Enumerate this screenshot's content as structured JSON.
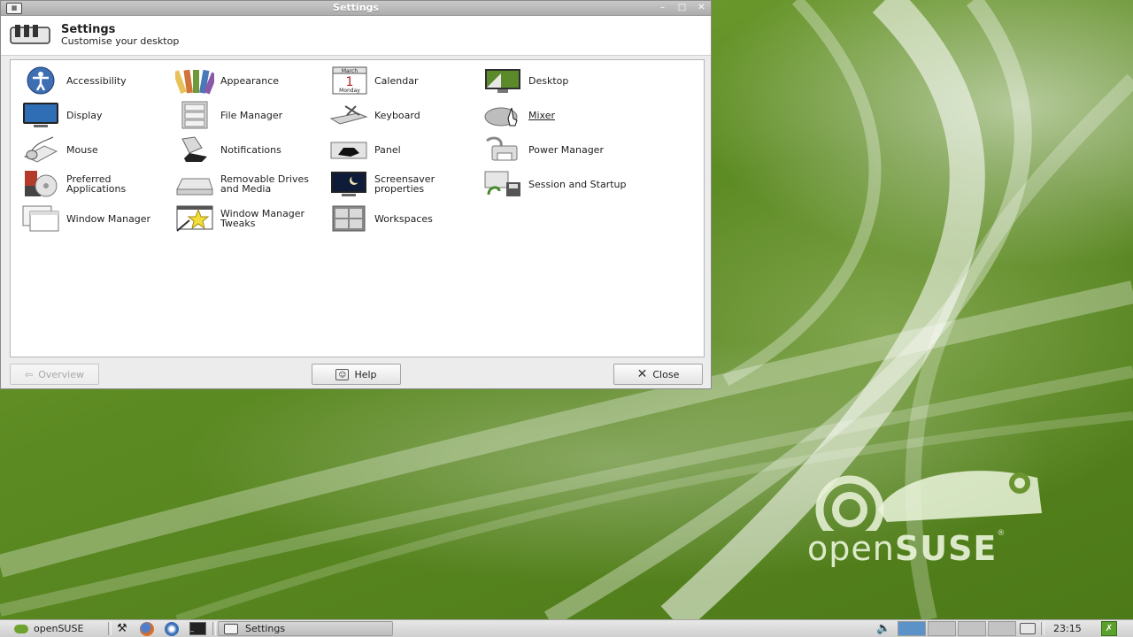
{
  "window": {
    "title": "Settings",
    "header_title": "Settings",
    "header_subtitle": "Customise your desktop"
  },
  "items": [
    {
      "label": "Accessibility",
      "icon": "accessibility-icon"
    },
    {
      "label": "Appearance",
      "icon": "appearance-icon"
    },
    {
      "label": "Calendar",
      "icon": "calendar-icon"
    },
    {
      "label": "Desktop",
      "icon": "desktop-icon"
    },
    {
      "label": "Display",
      "icon": "display-icon"
    },
    {
      "label": "File Manager",
      "icon": "file-manager-icon"
    },
    {
      "label": "Keyboard",
      "icon": "keyboard-icon"
    },
    {
      "label": "Mixer",
      "icon": "mixer-icon"
    },
    {
      "label": "Mouse",
      "icon": "mouse-icon"
    },
    {
      "label": "Notifications",
      "icon": "notifications-icon"
    },
    {
      "label": "Panel",
      "icon": "panel-icon"
    },
    {
      "label": "Power Manager",
      "icon": "power-manager-icon"
    },
    {
      "label": "Preferred Applications",
      "icon": "preferred-applications-icon"
    },
    {
      "label": "Removable Drives and Media",
      "icon": "removable-drives-icon"
    },
    {
      "label": "Screensaver properties",
      "icon": "screensaver-icon"
    },
    {
      "label": "Session and Startup",
      "icon": "session-startup-icon"
    },
    {
      "label": "Window Manager",
      "icon": "window-manager-icon"
    },
    {
      "label": "Window Manager Tweaks",
      "icon": "window-manager-tweaks-icon"
    },
    {
      "label": "Workspaces",
      "icon": "workspaces-icon"
    }
  ],
  "calendar_icon": {
    "month": "March",
    "day": "1",
    "weekday": "Monday"
  },
  "buttons": {
    "overview": "Overview",
    "help": "Help",
    "close": "Close"
  },
  "taskbar": {
    "menu_label": "openSUSE",
    "task_label": "Settings",
    "clock": "23:15"
  },
  "wallpaper": {
    "brand_open": "open",
    "brand_suse": "SUSE",
    "brand_mark": "®"
  },
  "colors": {
    "wallpaper_green": "#5f8a1f",
    "active_workspace": "#5b93c9"
  }
}
